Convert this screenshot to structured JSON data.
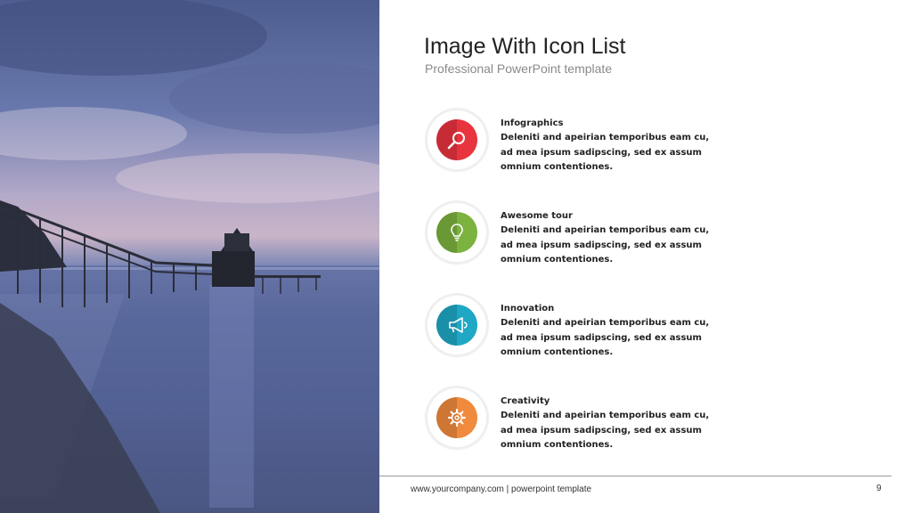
{
  "slide": {
    "title": "Image With Icon List",
    "subtitle": "Professional PowerPoint template"
  },
  "items": [
    {
      "heading": "Infographics",
      "body": "Deleniti and apeirian temporibus eam cu, ad mea ipsum sadipscing, sed ex assum omnium contentiones.",
      "icon": "magnifier-icon",
      "color": "#e8343f"
    },
    {
      "heading": "Awesome tour",
      "body": "Deleniti and apeirian temporibus eam cu, ad mea ipsum sadipscing, sed ex assum omnium contentiones.",
      "icon": "lightbulb-icon",
      "color": "#7cb23e"
    },
    {
      "heading": "Innovation",
      "body": "Deleniti and apeirian temporibus eam cu, ad mea ipsum sadipscing, sed ex assum omnium contentiones.",
      "icon": "megaphone-icon",
      "color": "#1fa7c4"
    },
    {
      "heading": "Creativity",
      "body": "Deleniti and apeirian temporibus eam cu, ad mea ipsum sadipscing, sed ex assum omnium contentiones.",
      "icon": "gear-icon",
      "color": "#f08a3c"
    }
  ],
  "footer": {
    "text": "www.yourcompany.com | powerpoint template",
    "page_number": "9"
  }
}
